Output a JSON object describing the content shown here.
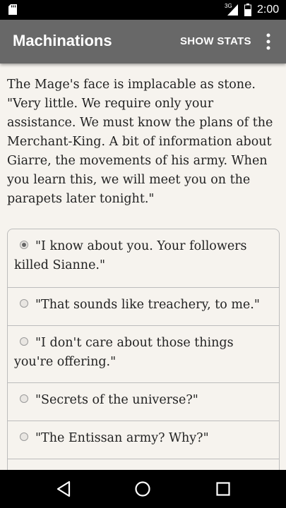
{
  "status_bar": {
    "network_type": "3G",
    "time": "2:00",
    "icons": [
      "sd-card-icon",
      "signal-icon",
      "battery-icon"
    ]
  },
  "toolbar": {
    "title": "Machinations",
    "show_stats_label": "SHOW STATS",
    "overflow_icon": "more-vert-icon"
  },
  "story": {
    "text": "The Mage's face is implacable as stone. \"Very little. We require only your assistance. We must know the plans of the Merchant-King. A bit of information about Giarre, the movements of his army. When you learn this, we will meet you on the parapets later tonight.\""
  },
  "choices": [
    {
      "label": "\"I know about you. Your followers killed Sianne.\"",
      "selected": true
    },
    {
      "label": "\"That sounds like treachery, to me.\"",
      "selected": false
    },
    {
      "label": "\"I don't care about those things you're offering.\"",
      "selected": false
    },
    {
      "label": "\"Secrets of the universe?\"",
      "selected": false
    },
    {
      "label": "\"The Entissan army? Why?\"",
      "selected": false
    },
    {
      "label": "",
      "selected": false
    }
  ],
  "nav_bar": {
    "icons": [
      "back-icon",
      "home-icon",
      "recents-icon"
    ]
  },
  "colors": {
    "toolbar": "#686868",
    "background": "#f6f3ee",
    "status_bar": "#000000",
    "nav_bar": "#000000"
  }
}
